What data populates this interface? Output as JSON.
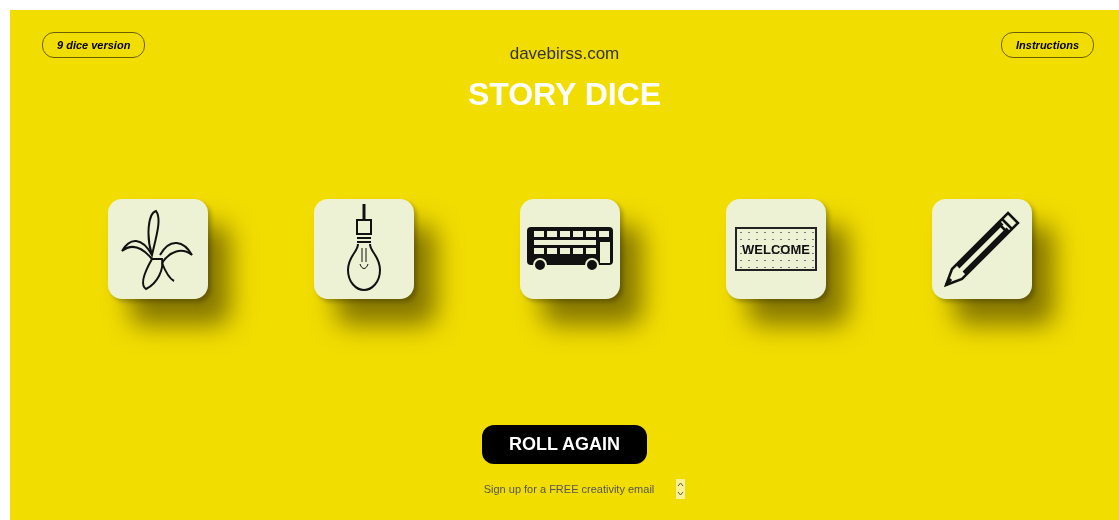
{
  "top_buttons": [
    {
      "label": "9 dice version"
    },
    {
      "label": "Instructions"
    }
  ],
  "site": "davebirss.com",
  "title": "STORY DICE",
  "dice": [
    {
      "kind": "banana"
    },
    {
      "kind": "bulb"
    },
    {
      "kind": "bus"
    },
    {
      "kind": "mat",
      "text": "WELCOME"
    },
    {
      "kind": "pencil"
    }
  ],
  "roll_button": "ROLL AGAIN",
  "signup": {
    "label": "Sign up for a FREE creativity email"
  }
}
